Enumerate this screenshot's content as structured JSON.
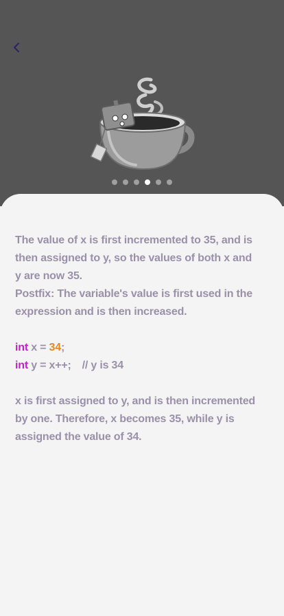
{
  "header": {
    "back_icon": "chevron-left-icon",
    "illustration": "coffee-cup-with-robot-icon"
  },
  "pager": {
    "count": 6,
    "active_index": 3
  },
  "content": {
    "para1_line1": "The value of x is first incremented to 35, and is",
    "para1_line2": "then assigned to y, so the values of both x and",
    "para1_line3": "y are now 35.",
    "para2_line1": "Postfix: The variable's value is first used in the",
    "para2_line2": "expression and is then increased.",
    "code1": {
      "keyword": "int",
      "text_before": " x = ",
      "number": "34",
      "text_after": ";"
    },
    "code2": {
      "keyword": "int",
      "text": " y = x++;",
      "comment": "// y is 34"
    },
    "para3_line1": "x is first assigned to y, and is then incremented",
    "para3_line2": "by one. Therefore, x becomes 35, while y is",
    "para3_line3": "assigned the value of 34."
  },
  "colors": {
    "header_bg": "#555555",
    "sheet_bg": "#f4f4f4",
    "text": "#9a90a8",
    "keyword": "#c21fc6",
    "number": "#e58a1a",
    "back_icon": "#2f2060"
  }
}
